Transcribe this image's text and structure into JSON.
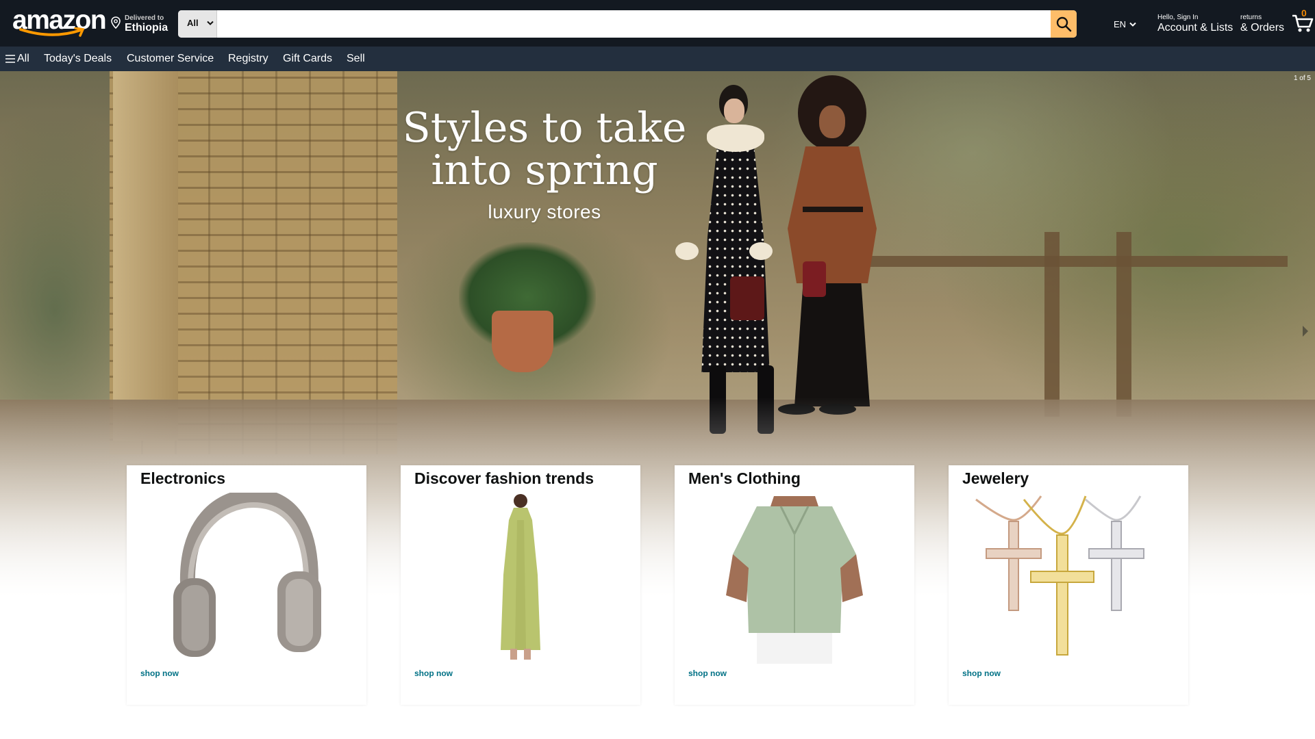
{
  "header": {
    "logo_text": "amazon",
    "deliver_label": "Delivered to",
    "deliver_location": "Ethiopia",
    "search": {
      "category": "All",
      "placeholder": "",
      "value": ""
    },
    "language": "EN",
    "account_line1": "Hello, Sign In",
    "account_line2": "Account & Lists",
    "orders_line1": "returns",
    "orders_line2": "& Orders",
    "cart_count": "0"
  },
  "subnav": {
    "all_label": "All",
    "items": [
      "Today's Deals",
      "Customer Service",
      "Registry",
      "Gift Cards",
      "Sell"
    ]
  },
  "hero": {
    "headline_line1": "Styles to take",
    "headline_line2": "into spring",
    "subline": "luxury stores",
    "counter": "1 of 5"
  },
  "cards": [
    {
      "title": "Electronics",
      "link": "shop now",
      "image_icon": "headphones-image"
    },
    {
      "title": "Discover fashion trends",
      "link": "shop now",
      "image_icon": "dress-image"
    },
    {
      "title": "Men's Clothing",
      "link": "shop now",
      "image_icon": "shirt-image"
    },
    {
      "title": "Jewelery",
      "link": "shop now",
      "image_icon": "cross-pendants-image"
    }
  ],
  "colors": {
    "header_bg": "#131921",
    "subnav_bg": "#232f3e",
    "search_button": "#febd69",
    "cart_count": "#f08804",
    "link": "#007185"
  }
}
